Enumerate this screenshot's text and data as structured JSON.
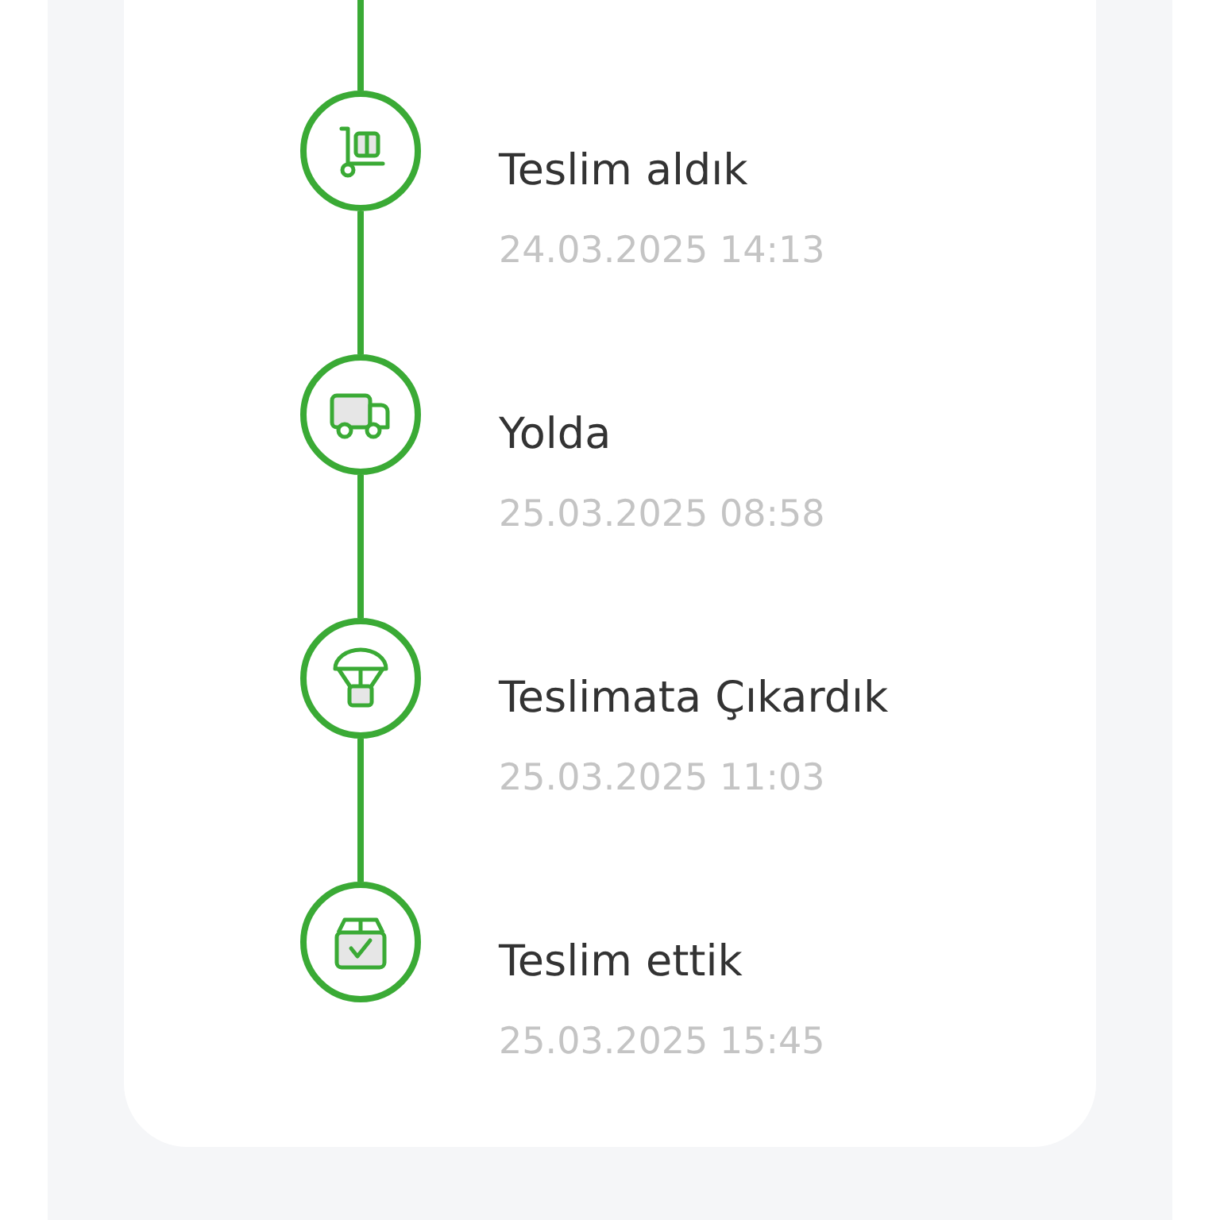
{
  "steps": [
    {
      "kind": "hand-truck",
      "title": "Teslim aldık",
      "date": "24.03.2025 14:13"
    },
    {
      "kind": "truck",
      "title": "Yolda",
      "date": "25.03.2025 08:58"
    },
    {
      "kind": "parachute",
      "title": "Teslimata Çıkardık",
      "date": "25.03.2025 11:03"
    },
    {
      "kind": "box-check",
      "title": "Teslim ettik",
      "date": "25.03.2025 15:45"
    }
  ]
}
